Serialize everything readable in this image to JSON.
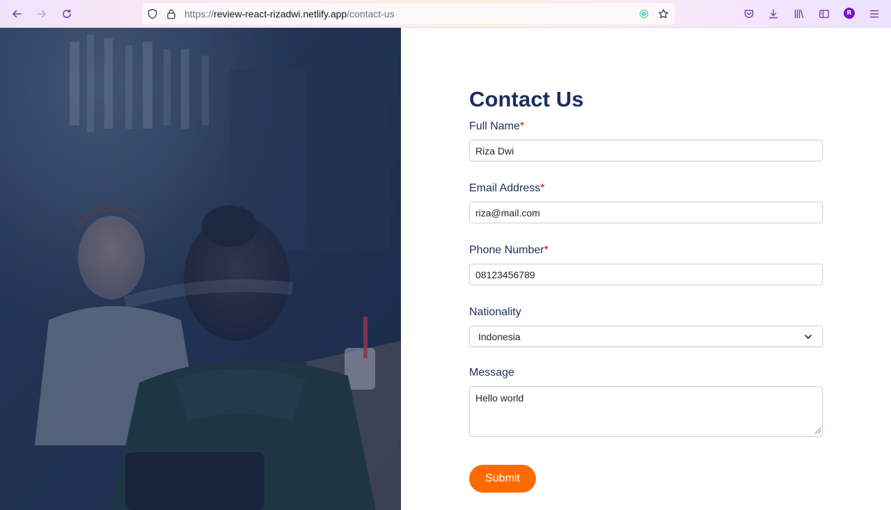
{
  "browser": {
    "url_protocol": "https://",
    "url_host": "review-react-rizadwi.netlify.app",
    "url_path": "/contact-us",
    "profile_initial": "R"
  },
  "form": {
    "title": "Contact Us",
    "required_marker": "*",
    "full_name": {
      "label": "Full Name",
      "value": "Riza Dwi"
    },
    "email": {
      "label": "Email Address",
      "value": "riza@mail.com"
    },
    "phone": {
      "label": "Phone Number",
      "value": "08123456789"
    },
    "nationality": {
      "label": "Nationality",
      "selected": "Indonesia"
    },
    "message": {
      "label": "Message",
      "value": "Hello world"
    },
    "submit_label": "Submit"
  },
  "colors": {
    "title": "#1c2f5a",
    "required": "#e00000",
    "submit_bg": "#ff6a00",
    "hero_overlay": "#1f2f4d",
    "profile_badge": "#7a12cc"
  }
}
